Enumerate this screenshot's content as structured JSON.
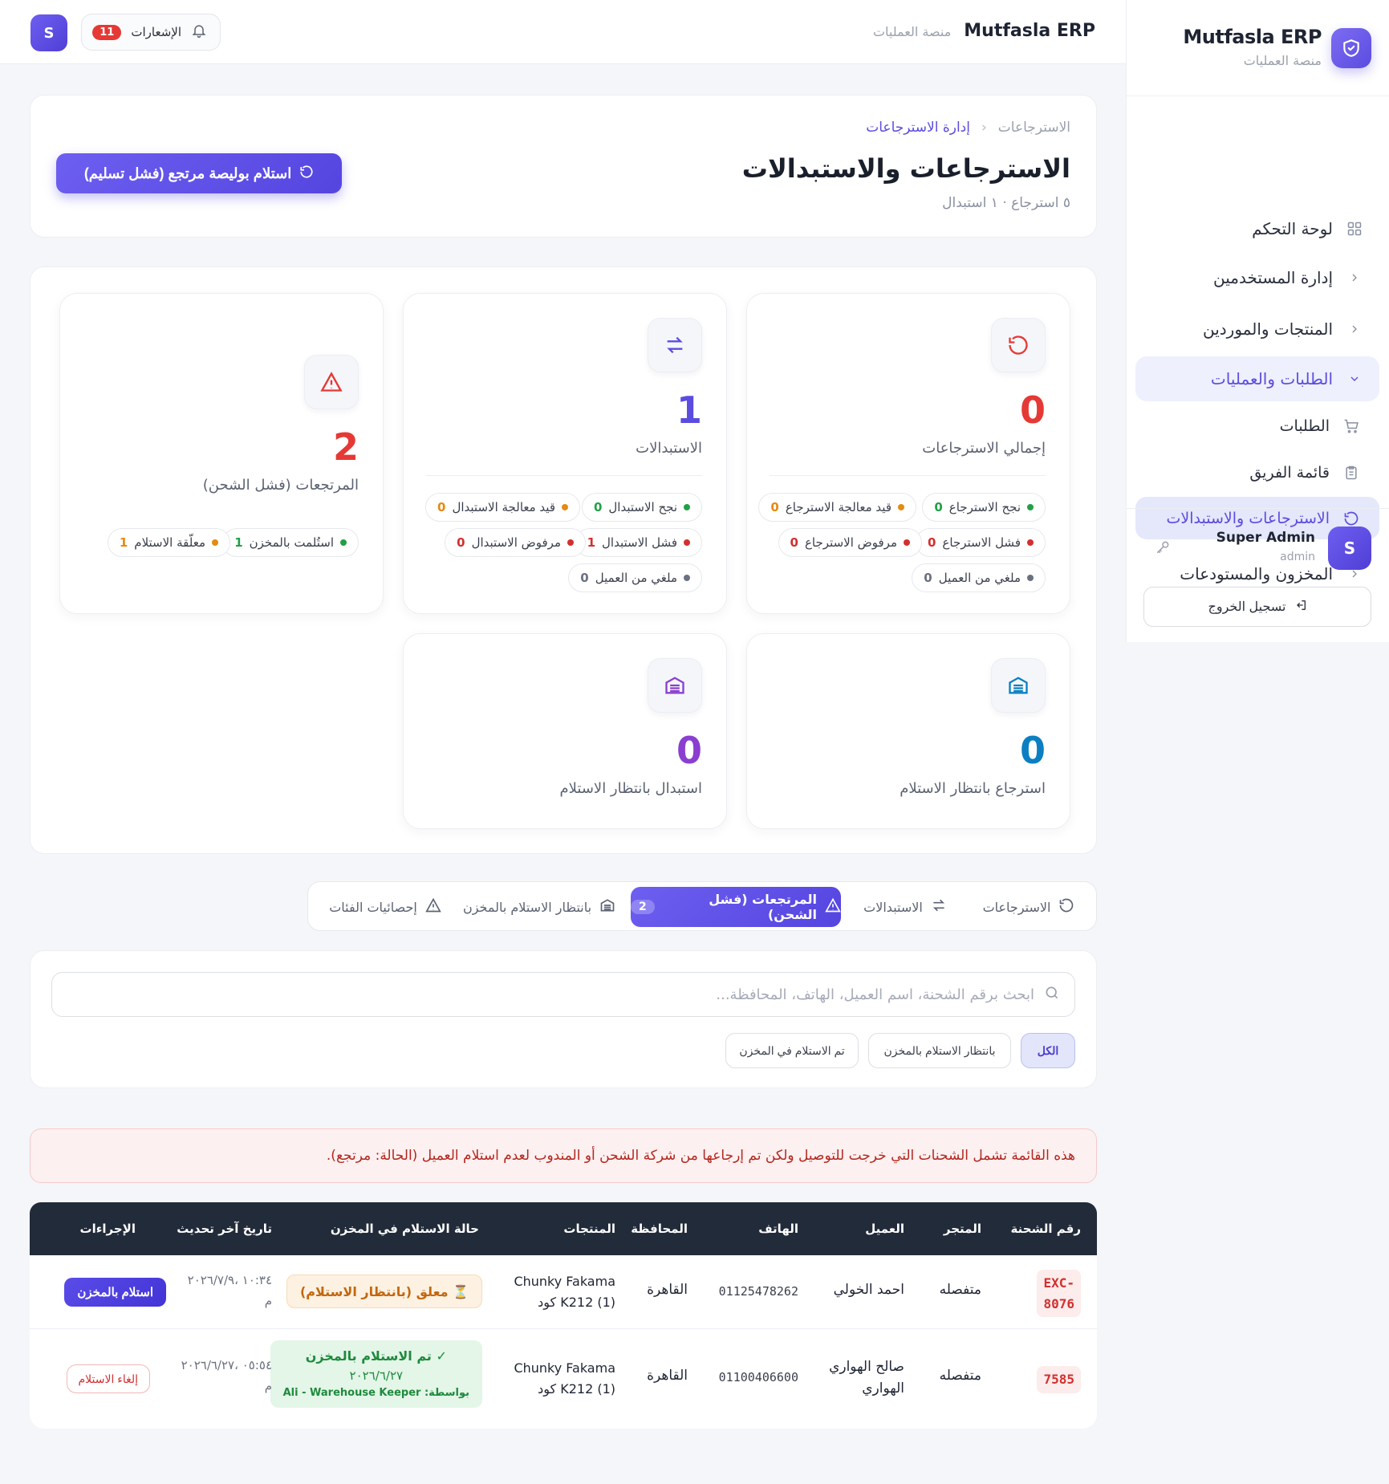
{
  "sidebar": {
    "title": "Mutfasla ERP",
    "subtitle": "منصة العمليات",
    "items": [
      {
        "label": "لوحة التحكم",
        "icon": "dashboard-icon"
      },
      {
        "label": "إدارة المستخدمين",
        "icon": "chevron-right-icon"
      },
      {
        "label": "المنتجات والموردين",
        "icon": "chevron-right-icon"
      },
      {
        "label": "الطلبات والعمليات",
        "icon": "chevron-down-icon"
      },
      {
        "label": "الطلبات",
        "icon": "cart-icon"
      },
      {
        "label": "قائمة الفريق",
        "icon": "clipboard-icon"
      },
      {
        "label": "الاسترجاعات والاستبدالات",
        "icon": "rotate-icon"
      },
      {
        "label": "المخزون والمستودعات",
        "icon": "chevron-right-icon"
      }
    ],
    "user": {
      "initial": "S",
      "name": "Super Admin",
      "role": "admin"
    },
    "logout_label": "تسجيل الخروج"
  },
  "topbar": {
    "brand": "Mutfasla ERP",
    "brand_sub": "منصة العمليات",
    "notifications_label": "الإشعارات",
    "notifications_count": "11",
    "avatar_initial": "S"
  },
  "header": {
    "breadcrumb": [
      "الاسترجاعات",
      "إدارة الاسترجاعات"
    ],
    "title": "الاسترجاعات والاستبدالات",
    "subtitle": "٥ استرجاع · ١ استبدال",
    "primary_button": "استلام بوليصة مرتجع (فشل تسليم)"
  },
  "stats": {
    "returns": {
      "value": "0",
      "label": "إجمالي الاسترجاعات",
      "chips": [
        {
          "label": "نجح الاسترجاع",
          "count": "0",
          "color": "#22a047"
        },
        {
          "label": "قيد معالجة الاسترجاع",
          "count": "0",
          "color": "#e58a12"
        },
        {
          "label": "فشل الاسترجاع",
          "count": "0",
          "color": "#d32f2f"
        },
        {
          "label": "مرفوض الاسترجاع",
          "count": "0",
          "color": "#d32f2f"
        },
        {
          "label": "ملغي من العميل",
          "count": "0",
          "color": "#6b7080"
        }
      ]
    },
    "exchanges": {
      "value": "1",
      "label": "الاستبدالات",
      "chips": [
        {
          "label": "نجح الاستبدال",
          "count": "0",
          "color": "#22a047"
        },
        {
          "label": "قيد معالجة الاستبدال",
          "count": "0",
          "color": "#e58a12"
        },
        {
          "label": "فشل الاستبدال",
          "count": "1",
          "color": "#d32f2f"
        },
        {
          "label": "مرفوض الاستبدال",
          "count": "0",
          "color": "#d32f2f"
        },
        {
          "label": "ملغي من العميل",
          "count": "0",
          "color": "#6b7080"
        }
      ]
    },
    "failed_shipping": {
      "value": "2",
      "label": "المرتجعات (فشل الشحن)",
      "chips": [
        {
          "label": "استُلمت بالمخزن",
          "count": "1",
          "color": "#22a047"
        },
        {
          "label": "معلّقة الاستلام",
          "count": "1",
          "color": "#e58a12"
        }
      ]
    },
    "return_pending": {
      "value": "0",
      "label": "استرجاع بانتظار الاستلام"
    },
    "exchange_pending": {
      "value": "0",
      "label": "استبدال بانتظار الاستلام"
    }
  },
  "tabs": [
    {
      "label": "الاسترجاعات",
      "icon": "rotate-icon"
    },
    {
      "label": "الاستبدالات",
      "icon": "swap-icon"
    },
    {
      "label": "المرتجعات (فشل الشحن)",
      "icon": "warning-icon",
      "badge": "2"
    },
    {
      "label": "بانتظار الاستلام بالمخزن",
      "icon": "warehouse-icon"
    },
    {
      "label": "إحصائيات الفئات",
      "icon": "warning-icon"
    }
  ],
  "search": {
    "placeholder": "ابحث برقم الشحنة، اسم العميل، الهاتف، المحافظة..."
  },
  "filters": [
    "الكل",
    "بانتظار الاستلام بالمخزن",
    "تم الاستلام في المخزن"
  ],
  "alert": "هذه القائمة تشمل الشحنات التي خرجت للتوصيل ولكن تم إرجاعها من شركة الشحن أو المندوب لعدم استلام العميل (الحالة: مرتجع).",
  "table": {
    "headers": [
      "رقم الشحنة",
      "المتجر",
      "العميل",
      "الهاتف",
      "المحافظة",
      "المنتجات",
      "حالة الاستلام في المخزن",
      "تاريخ آخر تحديث",
      "الإجراءات"
    ],
    "rows": [
      {
        "id_line1": "EXC-",
        "id_line2": "8076",
        "store": "متفصله",
        "customer": "احمد الخولي",
        "phone": "01125478262",
        "governorate": "القاهرة",
        "product_line1": "Chunky Fakama",
        "product_line2": "K212 (1) كود",
        "status": "⏳ معلق (بانتظار الاستلام)",
        "date_line1": "١٠:٣٤ ،٢٠٢٦/٧/٩",
        "date_line2": "م",
        "action": "استلام بالمخزن"
      },
      {
        "id_line1": "7585",
        "id_line2": "",
        "store": "متفصله",
        "customer_line1": "صالح الهواري",
        "customer_line2": "الهواري",
        "phone": "01100406600",
        "governorate": "القاهرة",
        "product_line1": "Chunky Fakama",
        "product_line2": "K212 (1) كود",
        "status_line1": "✓ تم الاستلام بالمخزن",
        "status_line2": "٢٠٢٦/٦/٢٧",
        "status_line3": "بواسطة: Ali - Warehouse Keeper",
        "date_line1": "٠٥:٥٤ ،٢٠٢٦/٦/٢٧",
        "date_line2": "م",
        "action": "إلغاء الاستلام"
      }
    ]
  }
}
